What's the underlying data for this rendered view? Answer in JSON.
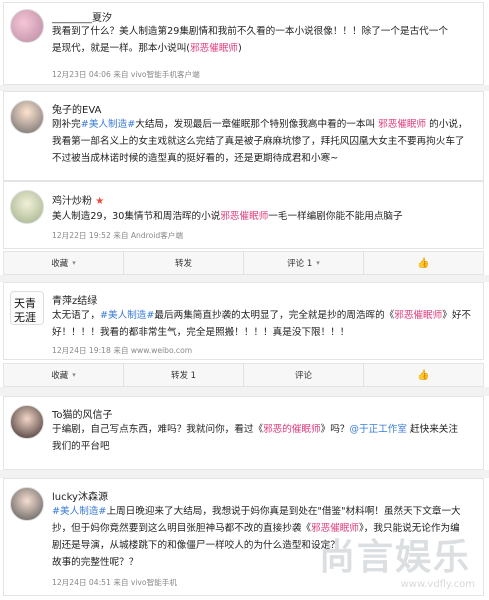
{
  "posts": [
    {
      "username": "________夏汐",
      "lines": [
        {
          "segs": [
            {
              "t": "我看到了什么？美人制造第29集剧情和我前不久看的一本小说很像！！！除了一个是古代一个"
            }
          ]
        },
        {
          "segs": [
            {
              "t": "是现代，就是一样。"
            },
            {
              "t": "那本小说叫("
            },
            {
              "t": "邪恶催眠师",
              "c": "pink"
            },
            {
              "t": ")"
            }
          ]
        }
      ],
      "meta": "12月23日 04:06 来自 vivo智能手机客户端"
    },
    {
      "username": "兔子的EVA",
      "lines": [
        {
          "segs": [
            {
              "t": "刚补完"
            },
            {
              "t": "#美人制造#",
              "c": "blue"
            },
            {
              "t": "大结局，发现最后一章催眠那个特别像我高中看的一本叫 "
            },
            {
              "t": "邪恶催眠师",
              "c": "pink"
            },
            {
              "t": " 的小说，"
            }
          ]
        },
        {
          "segs": [
            {
              "t": "我看第一部名义上的女主戏就这么完结了真是被子麻麻坑惨了，拜托风囚凰大女主不要再拘火车了"
            }
          ]
        },
        {
          "segs": [
            {
              "t": "不过被当成林诺时候的造型真的挺好看的，还是更期待成君和小寒~"
            }
          ]
        }
      ]
    },
    {
      "username": "鸡汁炒粉",
      "lines": [
        {
          "segs": [
            {
              "t": "美人制造29，30集情节和周浩晖的小说"
            },
            {
              "t": "邪恶催眠师",
              "c": "pink"
            },
            {
              "t": "一毛一样"
            },
            {
              "t": "编剧你能不能用点脑子"
            }
          ]
        }
      ],
      "meta": "12月22日 19:52 来自 Android客户端"
    },
    {
      "username": "青萍z结绿",
      "lines": [
        {
          "segs": [
            {
              "t": "太无语了，"
            },
            {
              "t": "#美人制造#",
              "c": "blue"
            },
            {
              "t": "最后两集简直抄袭的太明显了，完全就是抄的周浩晖的《"
            },
            {
              "t": "邪恶催眠师",
              "c": "pink"
            },
            {
              "t": "》好不"
            }
          ]
        },
        {
          "segs": [
            {
              "t": "好！！！！我看的都非常生气，完全是照搬！！！！真是没下限！！！"
            }
          ]
        }
      ],
      "meta": "12月24日 19:18 来自 www.weibo.com"
    },
    {
      "username": "To猫的风信子",
      "lines": [
        {
          "segs": [
            {
              "t": "于编剧，自己写点东西，难吗？我就问你，看过《"
            },
            {
              "t": "邪恶的催眠师",
              "c": "pink"
            },
            {
              "t": "》吗？"
            },
            {
              "t": "@于正工作室",
              "c": "blue"
            },
            {
              "t": " 赶快来关注"
            }
          ]
        },
        {
          "segs": [
            {
              "t": "我们的平台吧"
            }
          ]
        }
      ]
    },
    {
      "username": "lucky沐森源",
      "lines": [
        {
          "segs": [
            {
              "t": "#美人制造#",
              "c": "blue"
            },
            {
              "t": "上周日晚迎来了大结局，我想说于妈你真是到处在\"借鉴\"材料啊！虽然天下文章一大"
            }
          ]
        },
        {
          "segs": [
            {
              "t": "抄，但于妈你竟然要到这么明目张胆神马都不改的直接抄袭《"
            },
            {
              "t": "邪恶催眠师",
              "c": "pink"
            },
            {
              "t": "》，我只能说无论作为编"
            }
          ]
        },
        {
          "segs": [
            {
              "t": "剧还是导演，从城楼跳下的和像僵尸一样咬人的为什么造型和设定？"
            }
          ]
        },
        {
          "segs": [
            {
              "t": "故事的完整性呢？？"
            }
          ]
        }
      ],
      "meta": "12月24日 04:51 来自 vivo智能手机"
    }
  ],
  "actions_bar_1": {
    "fav": "收藏",
    "repost": "转发",
    "comment": "评论 1",
    "like": ""
  },
  "actions_bar_2": {
    "fav": "收藏",
    "repost": "转发 1",
    "comment": "评论",
    "like": ""
  },
  "watermark": {
    "brand": "尚言娱乐",
    "url": "www.vdfly.com"
  }
}
